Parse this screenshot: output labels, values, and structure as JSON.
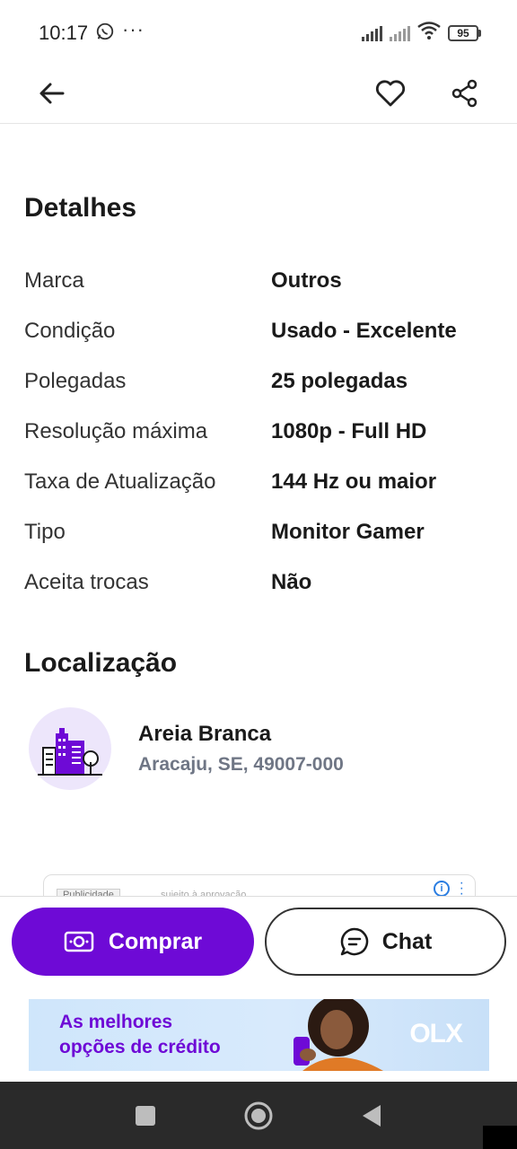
{
  "status_bar": {
    "time": "10:17",
    "dots": "···",
    "battery": "95"
  },
  "app_bar": {
    "back_icon": "arrow-left-icon",
    "favorite_icon": "heart-outline-icon",
    "share_icon": "share-icon"
  },
  "details": {
    "title": "Detalhes",
    "rows": [
      {
        "label": "Marca",
        "value": "Outros"
      },
      {
        "label": "Condição",
        "value": "Usado - Excelente"
      },
      {
        "label": "Polegadas",
        "value": "25 polegadas"
      },
      {
        "label": "Resolução máxima",
        "value": "1080p - Full HD"
      },
      {
        "label": "Taxa de Atualização",
        "value": "144 Hz ou maior"
      },
      {
        "label": "Tipo",
        "value": "Monitor Gamer"
      },
      {
        "label": "Aceita trocas",
        "value": "Não"
      }
    ]
  },
  "location": {
    "title": "Localização",
    "neighborhood": "Areia Branca",
    "address": "Aracaju, SE, 49007-000"
  },
  "ad": {
    "tag": "Publicidade",
    "muted_text": "sujeito à aprovação"
  },
  "actions": {
    "buy_label": "Comprar",
    "chat_label": "Chat"
  },
  "banner": {
    "line1": "As melhores",
    "line2": "opções de crédito",
    "brand": "OLX"
  },
  "colors": {
    "primary": "#6e0ad6",
    "text": "#1a1a1a",
    "muted": "#6f7685"
  }
}
